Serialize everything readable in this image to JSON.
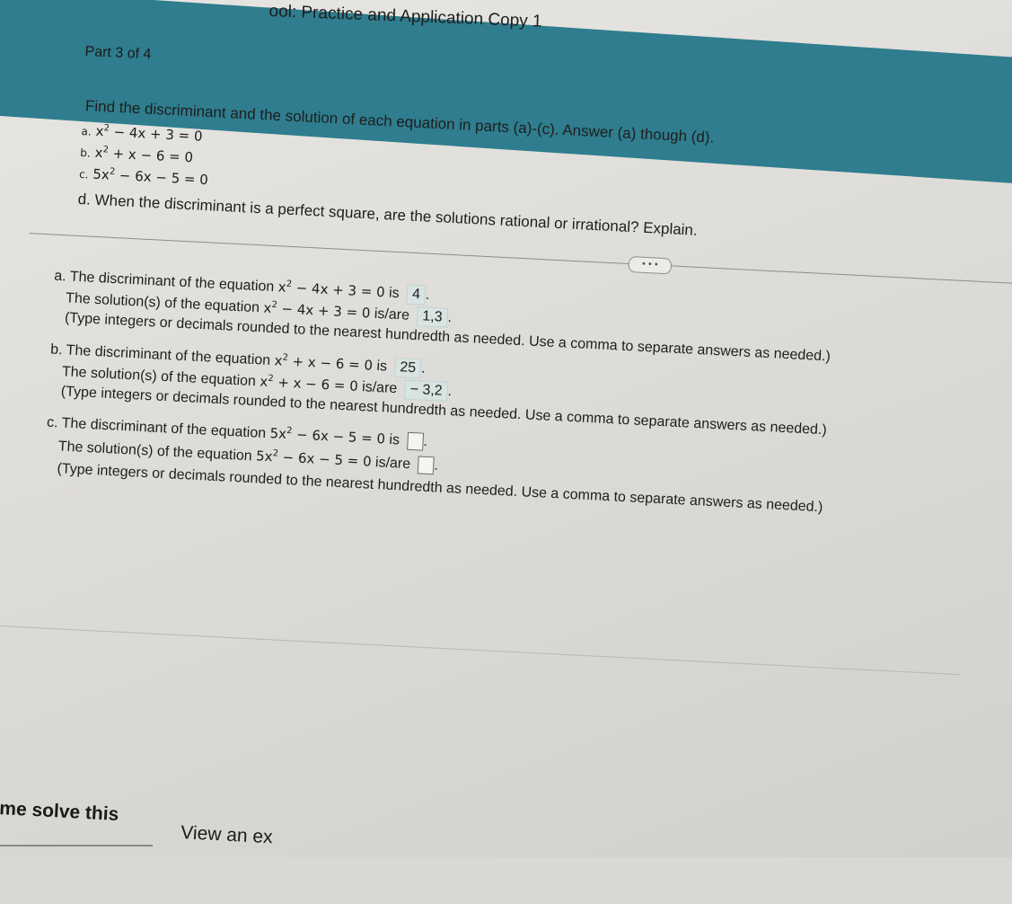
{
  "header": {
    "title": "ool: Practice and Application Copy 1",
    "part": "Part 3 of 4"
  },
  "question": {
    "prompt": "Find the discriminant and the solution of each equation in parts (a)-(c). Answer (a) though (d).",
    "items": [
      {
        "letter": "a.",
        "lhs": "x",
        "rest": " − 4x + 3 = 0"
      },
      {
        "letter": "b.",
        "lhs": "x",
        "rest": " + x − 6 = 0"
      },
      {
        "letter": "c.",
        "lhs": "5x",
        "rest": " − 6x − 5 = 0"
      }
    ],
    "item_d": "d. When the discriminant is a perfect square, are the solutions rational or irrational? Explain."
  },
  "more_button": "• • •",
  "answers": {
    "a": {
      "disc_label": "a. The discriminant of the equation",
      "eq_lhs": "x",
      "eq_rest": " − 4x + 3 = 0",
      "is": "is",
      "disc_value": "4",
      "sol_label": "The solution(s) of the equation",
      "is_are": "is/are",
      "sol_value": "1,3",
      "hint": "(Type integers or decimals rounded to the nearest hundredth as needed. Use a comma to separate answers as needed.)"
    },
    "b": {
      "disc_label": "b. The discriminant of the equation",
      "eq_lhs": "x",
      "eq_rest": " + x − 6 = 0",
      "is": "is",
      "disc_value": "25",
      "sol_label": "The solution(s) of the equation",
      "is_are": "is/are",
      "sol_value": "− 3,2",
      "hint": "(Type integers or decimals rounded to the nearest hundredth as needed. Use a comma to separate answers as needed.)"
    },
    "c": {
      "disc_label": "c. The discriminant of the equation",
      "eq_lhs": "5x",
      "eq_rest": " − 6x − 5 = 0",
      "is": "is",
      "sol_label": "The solution(s) of the equation",
      "is_are": "is/are",
      "hint": "(Type integers or decimals rounded to the nearest hundredth as needed. Use a comma to separate answers as needed.)"
    }
  },
  "footer": {
    "help_button": "me solve this",
    "example_button": "View an ex"
  }
}
